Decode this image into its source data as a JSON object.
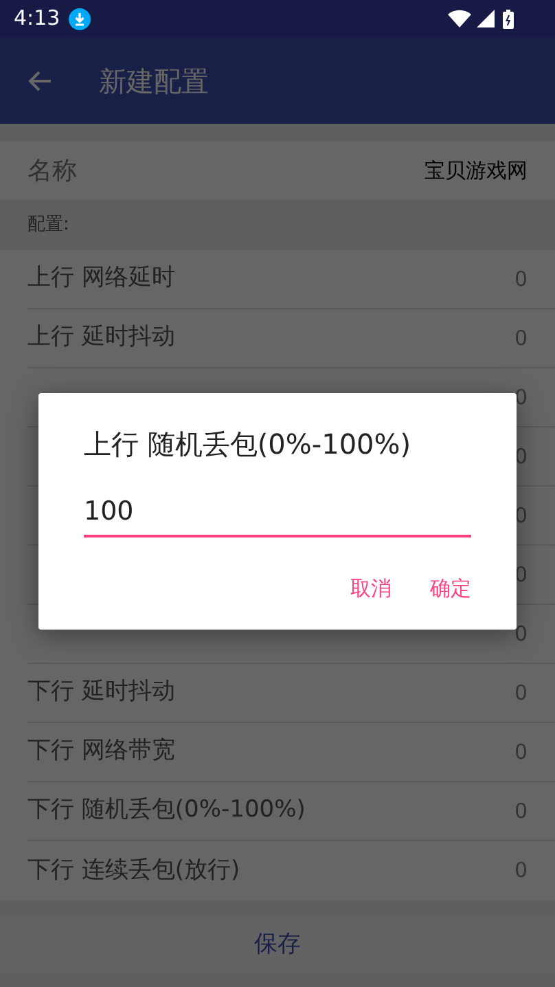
{
  "status_bar": {
    "time": "4:13"
  },
  "toolbar": {
    "title": "新建配置"
  },
  "name_row": {
    "label": "名称",
    "value": "宝贝游戏网"
  },
  "section_label": "配置:",
  "rows": [
    {
      "label": "上行 网络延时",
      "value": "0"
    },
    {
      "label": "上行 延时抖动",
      "value": "0"
    },
    {
      "value": "0"
    },
    {
      "value": "0"
    },
    {
      "value": "0"
    },
    {
      "value": "0"
    },
    {
      "value": "0"
    },
    {
      "label": "下行 延时抖动",
      "value": "0"
    },
    {
      "label": "下行 网络带宽",
      "value": "0"
    },
    {
      "label": "下行 随机丢包(0%-100%)",
      "value": "0"
    },
    {
      "label": "下行 连续丢包(放行)",
      "value": "0"
    }
  ],
  "save_button": "保存",
  "dialog": {
    "title": "上行 随机丢包(0%-100%)",
    "value": "100",
    "buttons": [
      "取消",
      "确定"
    ]
  }
}
